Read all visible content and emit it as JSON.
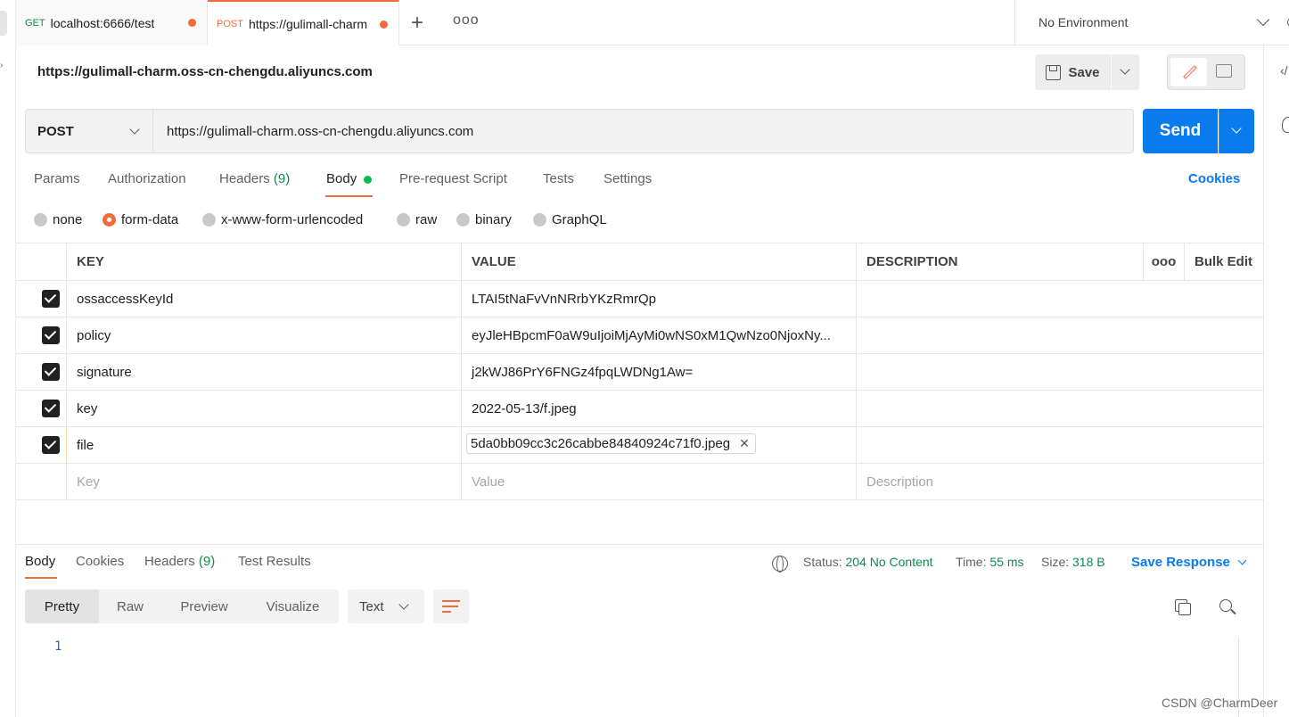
{
  "tabs": [
    {
      "method": "GET",
      "title": "localhost:6666/test"
    },
    {
      "method": "POST",
      "title": "https://gulimall-charm"
    }
  ],
  "tabbar": {
    "plus": "+",
    "more": "ooo"
  },
  "environment": {
    "label": "No Environment"
  },
  "request": {
    "title": "https://gulimall-charm.oss-cn-chengdu.aliyuncs.com",
    "save_label": "Save",
    "method": "POST",
    "url": "https://gulimall-charm.oss-cn-chengdu.aliyuncs.com",
    "send_label": "Send"
  },
  "request_tabs": {
    "params": "Params",
    "authorization": "Authorization",
    "headers": "Headers",
    "headers_count": "(9)",
    "body": "Body",
    "prerequest": "Pre-request Script",
    "tests": "Tests",
    "settings": "Settings",
    "cookies": "Cookies"
  },
  "body_types": [
    "none",
    "form-data",
    "x-www-form-urlencoded",
    "raw",
    "binary",
    "GraphQL"
  ],
  "body_type_selected": "form-data",
  "table": {
    "headers": {
      "key": "KEY",
      "value": "VALUE",
      "description": "DESCRIPTION",
      "more": "ooo",
      "bulk_edit": "Bulk Edit"
    },
    "rows": [
      {
        "key": "ossaccessKeyId",
        "value": "LTAI5tNaFvVnNRrbYKzRmrQp"
      },
      {
        "key": "policy",
        "value": "eyJleHBpcmF0aW9uIjoiMjAyMi0wNS0xM1QwNzo0NjoxNy..."
      },
      {
        "key": "signature",
        "value": "j2kWJ86PrY6FNGz4fpqLWDNg1Aw="
      },
      {
        "key": "key",
        "value": "2022-05-13/f.jpeg"
      },
      {
        "key": "file",
        "value": "5da0bb09cc3c26cabbe84840924c71f0.jpeg"
      }
    ],
    "placeholders": {
      "key": "Key",
      "value": "Value",
      "description": "Description"
    }
  },
  "response": {
    "tabs": {
      "body": "Body",
      "cookies": "Cookies",
      "headers": "Headers",
      "headers_count": "(9)",
      "test_results": "Test Results"
    },
    "status_label": "Status:",
    "status_value": "204 No Content",
    "time_label": "Time:",
    "time_value": "55 ms",
    "size_label": "Size:",
    "size_value": "318 B",
    "save_response": "Save Response",
    "views": {
      "pretty": "Pretty",
      "raw": "Raw",
      "preview": "Preview",
      "visualize": "Visualize"
    },
    "format": "Text",
    "line_number": "1"
  },
  "icons": {
    "save": "save-icon",
    "edit": "pencil-icon",
    "comment": "comment-icon",
    "globe": "globe-icon",
    "copy": "copy-icon",
    "search": "search-icon",
    "wrap": "wrap-lines-icon",
    "eye": "eye-icon",
    "code": "code-icon",
    "bulb": "lightbulb-icon"
  },
  "colors": {
    "accent": "#f26b3a",
    "primary": "#097bed",
    "success": "#0f8a4f"
  },
  "watermark": "CSDN @CharmDeer"
}
